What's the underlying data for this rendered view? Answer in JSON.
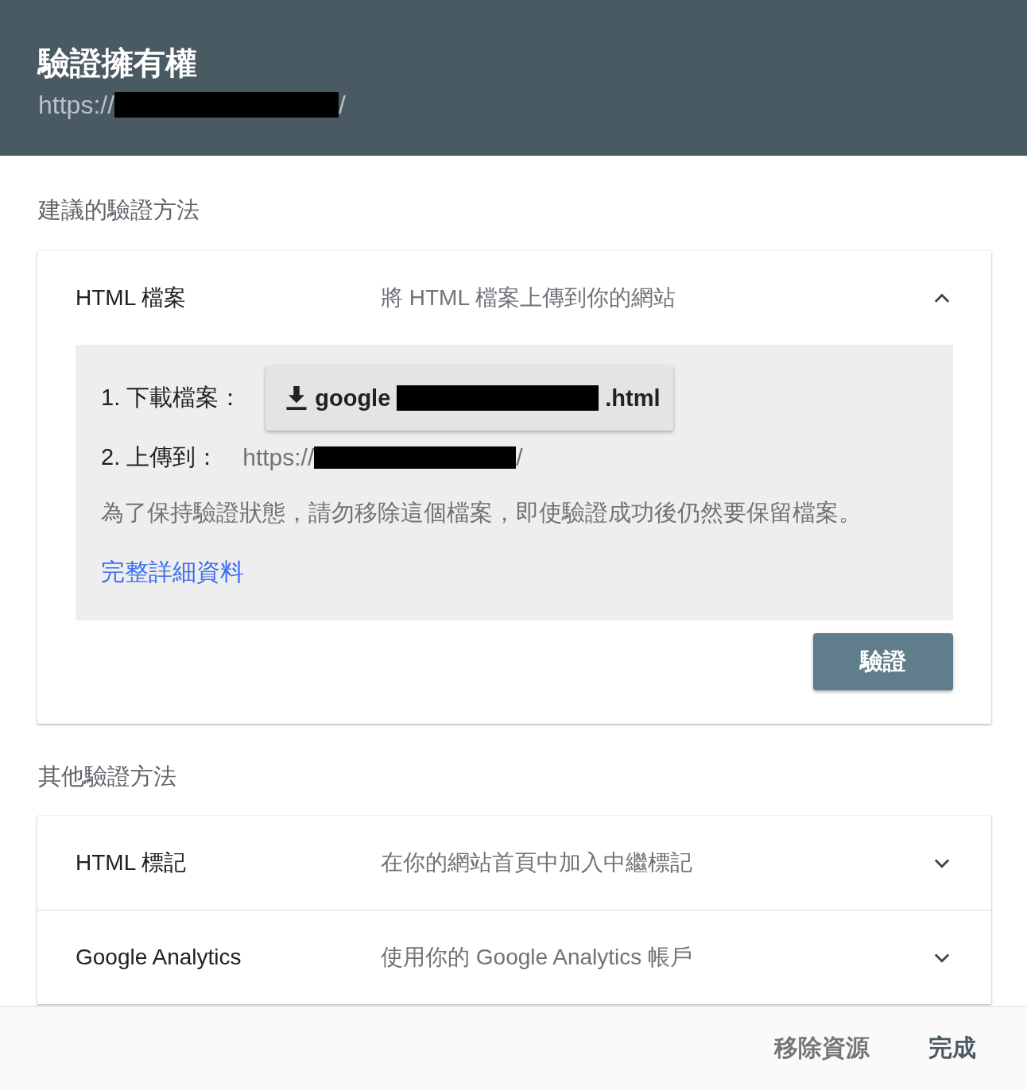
{
  "dialog": {
    "title": "驗證擁有權",
    "url_prefix": "https://",
    "url_suffix": "/"
  },
  "recommended": {
    "heading": "建議的驗證方法",
    "methods": [
      {
        "name": "HTML 檔案",
        "description": "將 HTML 檔案上傳到你的網站",
        "expanded": true,
        "details": {
          "step_1_label": "1. 下載檔案：",
          "file_prefix": "google",
          "file_suffix": ".html",
          "step_2_label": "2. 上傳到：",
          "upload_url_prefix": "https://",
          "upload_url_suffix": "/",
          "note": "為了保持驗證狀態，請勿移除這個檔案，即使驗證成功後仍然要保留檔案。",
          "details_link": "完整詳細資料",
          "verify_button": "驗證"
        }
      }
    ]
  },
  "other": {
    "heading": "其他驗證方法",
    "methods": [
      {
        "name": "HTML 標記",
        "description": "在你的網站首頁中加入中繼標記",
        "expanded": false
      },
      {
        "name": "Google Analytics",
        "description": "使用你的 Google Analytics 帳戶",
        "expanded": false
      }
    ]
  },
  "footer": {
    "buttons": [
      "移除資源",
      "完成"
    ]
  }
}
